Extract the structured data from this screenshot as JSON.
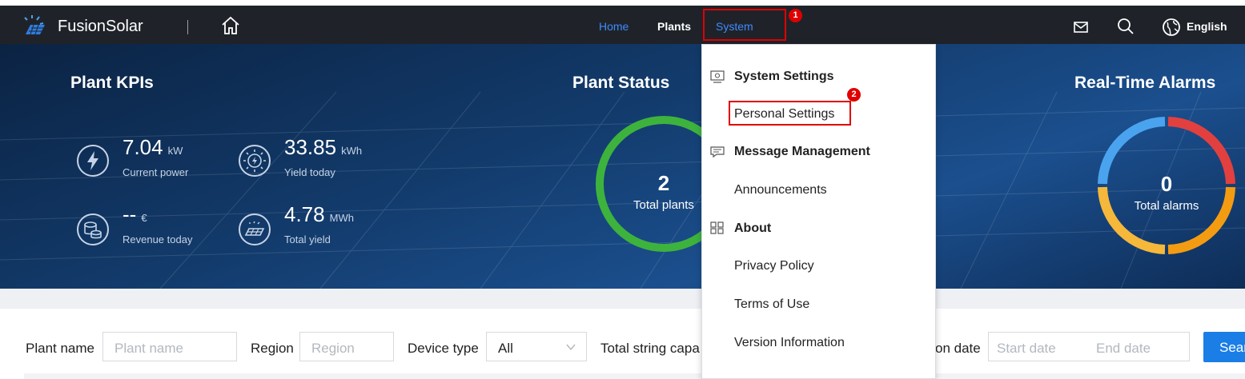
{
  "topbar": {
    "brand": "FusionSolar",
    "nav": {
      "home": "Home",
      "plants": "Plants",
      "system": "System"
    },
    "language": "English",
    "icons": [
      "logo-icon",
      "home-icon",
      "mail-icon",
      "search-icon",
      "globe-icon"
    ]
  },
  "annotations": {
    "badge1": "1",
    "badge2": "2",
    "highlight_color": "#e00000"
  },
  "hero": {
    "kpi_title": "Plant KPIs",
    "status_title": "Plant Status",
    "alarms_title": "Real-Time Alarms",
    "kpis": [
      {
        "value": "7.04",
        "unit": "kW",
        "label": "Current power",
        "icon": "lightning-icon"
      },
      {
        "value": "33.85",
        "unit": "kWh",
        "label": "Yield today",
        "icon": "sun-icon"
      },
      {
        "value": "--",
        "unit": "€",
        "label": "Revenue today",
        "icon": "coins-icon"
      },
      {
        "value": "4.78",
        "unit": "MWh",
        "label": "Total yield",
        "icon": "solar-panel-icon"
      }
    ],
    "status": {
      "value": "2",
      "label": "Total plants",
      "ring_color": "#3db33d"
    },
    "alarms": {
      "value": "0",
      "label": "Total alarms",
      "ring_colors": [
        "#e2403f",
        "#f39c12",
        "#f5b83a",
        "#4aa3ef"
      ]
    }
  },
  "dropdown": {
    "sections": [
      {
        "heading": "System Settings",
        "icon": "monitor-settings-icon",
        "items": [
          "Personal Settings"
        ]
      },
      {
        "heading": "Message Management",
        "icon": "message-icon",
        "items": [
          "Announcements"
        ]
      },
      {
        "heading": "About",
        "icon": "grid-icon",
        "items": [
          "Privacy Policy",
          "Terms of Use",
          "Version Information"
        ]
      }
    ]
  },
  "filters": {
    "plant_name_label": "Plant name",
    "plant_name_placeholder": "Plant name",
    "region_label": "Region",
    "region_placeholder": "Region",
    "device_type_label": "Device type",
    "device_type_value": "All",
    "string_capacity_label": "Total string capa",
    "date_label": "on date",
    "start_date_placeholder": "Start date",
    "end_date_placeholder": "End date",
    "search_button": "Sear"
  }
}
